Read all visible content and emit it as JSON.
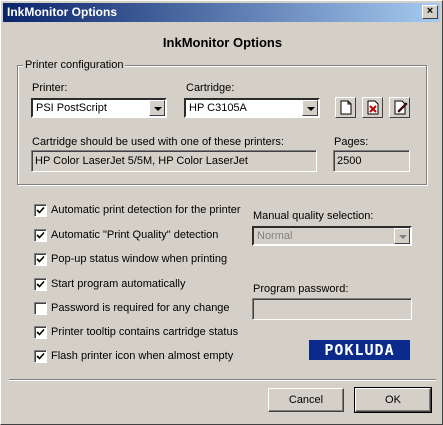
{
  "window": {
    "title": "InkMonitor Options",
    "heading": "InkMonitor Options"
  },
  "printer_config": {
    "group_title": "Printer configuration",
    "printer_label": "Printer:",
    "printer_value": "PSI PostScript",
    "cartridge_label": "Cartridge:",
    "cartridge_value": "HP C3105A",
    "compat_label": "Cartridge should be used with one of these printers:",
    "compat_value": "HP Color LaserJet 5/5M, HP Color LaserJet",
    "pages_label": "Pages:",
    "pages_value": "2500",
    "tool_icons": [
      "new-document-icon",
      "delete-document-icon",
      "edit-document-icon"
    ]
  },
  "options": [
    {
      "label": "Automatic print detection for the printer",
      "checked": true
    },
    {
      "label": "Automatic \"Print Quality\" detection",
      "checked": true
    },
    {
      "label": "Pop-up status window when printing",
      "checked": true
    },
    {
      "label": "Start program automatically",
      "checked": true
    },
    {
      "label": "Password is required for any change",
      "checked": false
    },
    {
      "label": "Printer tooltip contains cartridge status",
      "checked": true
    },
    {
      "label": "Flash printer icon when almost empty",
      "checked": true
    }
  ],
  "quality": {
    "label": "Manual quality selection:",
    "value": "Normal"
  },
  "password": {
    "label": "Program password:",
    "value": ""
  },
  "logo_text": "POKLUDA",
  "buttons": {
    "cancel": "Cancel",
    "ok": "OK"
  },
  "colors": {
    "title_bar": "#0a246a",
    "logo_bg": "#0b2a8c",
    "face": "#d4d0c8"
  }
}
